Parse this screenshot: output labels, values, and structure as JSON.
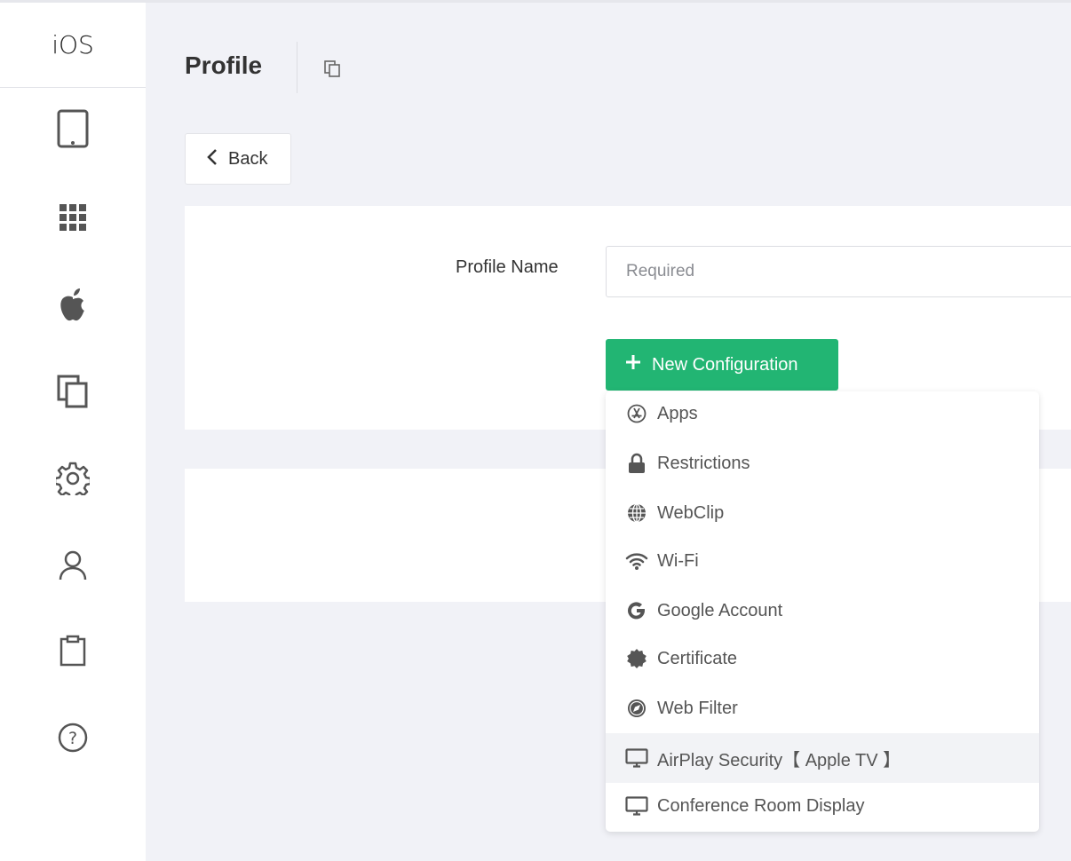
{
  "sidebar": {
    "brand": "iOS",
    "items": [
      {
        "name": "devices",
        "icon": "tablet-icon"
      },
      {
        "name": "apps",
        "icon": "grid-icon"
      },
      {
        "name": "apple",
        "icon": "apple-icon"
      },
      {
        "name": "profiles",
        "icon": "copy-icon"
      },
      {
        "name": "settings",
        "icon": "gear-icon"
      },
      {
        "name": "users",
        "icon": "user-icon"
      },
      {
        "name": "reports",
        "icon": "clipboard-icon"
      },
      {
        "name": "help",
        "icon": "help-icon"
      }
    ]
  },
  "header": {
    "title": "Profile",
    "copy_icon": "copy-icon"
  },
  "back": {
    "label": "Back"
  },
  "form": {
    "profile_name_label": "Profile Name",
    "profile_name_value": "",
    "profile_name_placeholder": "Required",
    "new_config_label": "New Configuration"
  },
  "dropdown": {
    "items": [
      {
        "label": "Apps",
        "icon": "app-store-icon"
      },
      {
        "label": "Restrictions",
        "icon": "lock-icon"
      },
      {
        "label": "WebClip",
        "icon": "globe-icon"
      },
      {
        "label": "Wi-Fi",
        "icon": "wifi-icon"
      },
      {
        "label": "Google Account",
        "icon": "google-icon"
      },
      {
        "label": "Certificate",
        "icon": "certificate-icon"
      },
      {
        "label": "Web Filter",
        "icon": "compass-icon"
      },
      {
        "label": "AirPlay Security【 Apple TV 】",
        "icon": "monitor-icon"
      },
      {
        "label": "Conference Room Display",
        "icon": "monitor-icon"
      }
    ],
    "highlighted_index": 7
  },
  "colors": {
    "accent_green": "#22b573",
    "background": "#f1f2f7",
    "icon_gray": "#555555"
  }
}
